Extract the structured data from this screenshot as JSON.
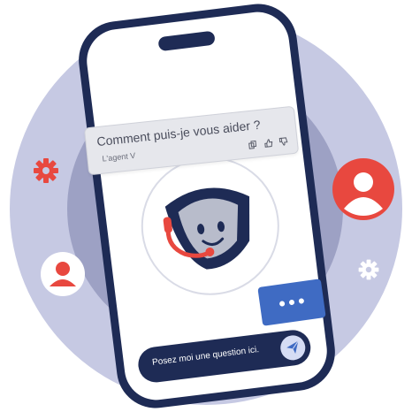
{
  "bubble": {
    "title": "Comment puis-je vous aider ?",
    "agent": "L'agent V"
  },
  "chat": {
    "placeholder": "Posez moi une question ici."
  },
  "icons": {
    "copy": "copy-icon",
    "thumbs_up": "thumbs-up-icon",
    "thumbs_down": "thumbs-down-icon",
    "send": "send-icon",
    "gear": "gear-icon",
    "user": "user-icon",
    "mascot": "shield-mascot-icon"
  },
  "colors": {
    "navy": "#1e2b55",
    "accent_red": "#e8483f",
    "accent_blue": "#3f6bc3",
    "circle_outer": "#c6c9e3",
    "circle_inner": "#9da1c4"
  }
}
